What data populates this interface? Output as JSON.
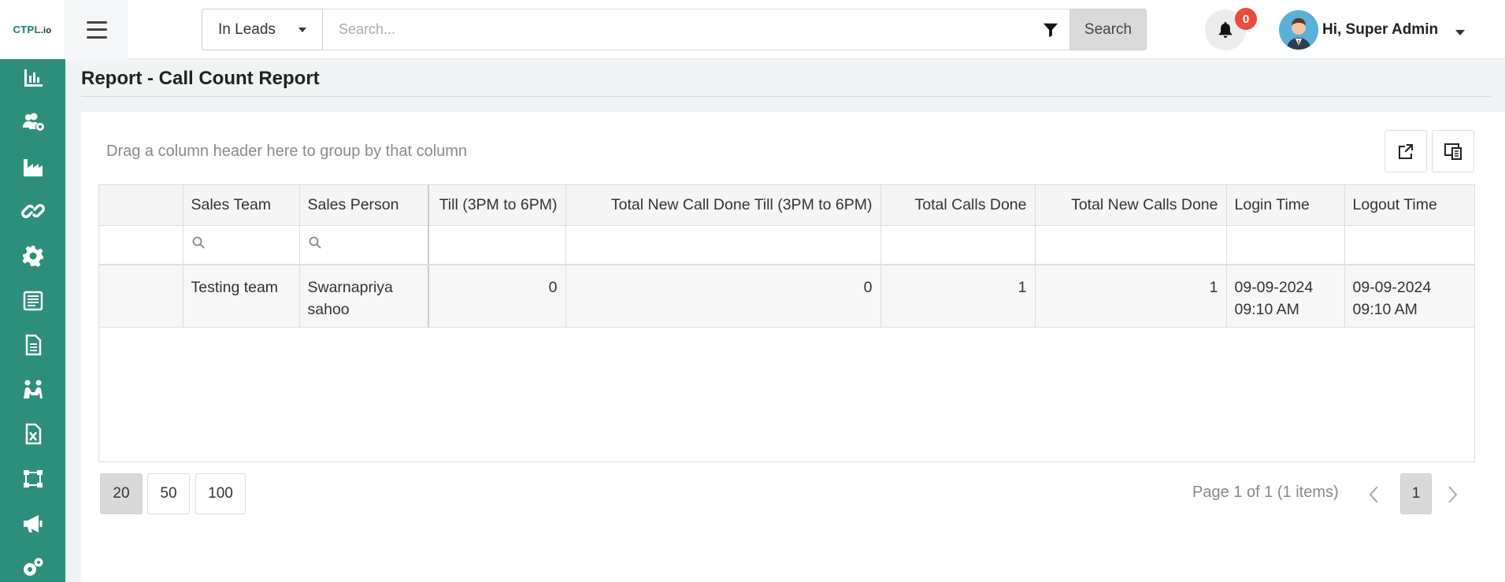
{
  "app": {
    "logo_text": "CTPL",
    "logo_suffix": ".io"
  },
  "search": {
    "scope": "In Leads",
    "placeholder": "Search...",
    "button_label": "Search"
  },
  "notifications": {
    "count": "0"
  },
  "user": {
    "greeting": "Hi, Super Admin"
  },
  "sidebar": {
    "items": [
      {
        "icon": "bar-chart-icon"
      },
      {
        "icon": "users-cog-icon"
      },
      {
        "icon": "industry-icon"
      },
      {
        "icon": "link-icon"
      },
      {
        "icon": "gear-icon"
      },
      {
        "icon": "newspaper-icon"
      },
      {
        "icon": "document-icon"
      },
      {
        "icon": "people-meeting-icon"
      },
      {
        "icon": "excel-file-icon"
      },
      {
        "icon": "network-icon"
      },
      {
        "icon": "megaphone-icon"
      },
      {
        "icon": "cogs-icon"
      }
    ],
    "color": "#2d8f7b"
  },
  "page": {
    "title": "Report - Call Count Report"
  },
  "grid": {
    "group_hint": "Drag a column header here to group by that column",
    "columns": [
      "",
      "Sales Team",
      "Sales Person",
      "Till (3PM to 6PM)",
      "Total New Call Done Till (3PM to 6PM)",
      "Total Calls Done",
      "Total New Calls Done",
      "Login Time",
      "Logout Time"
    ],
    "rows": [
      {
        "sales_team": "Testing team",
        "sales_person_line1": "Swarnapriya",
        "sales_person_line2": "sahoo",
        "till_3_6": "0",
        "new_till_3_6": "0",
        "total_calls": "1",
        "total_new_calls": "1",
        "login_line1": "09-09-2024",
        "login_line2": "09:10 AM",
        "logout_line1": "09-09-2024",
        "logout_line2": "09:10 AM"
      }
    ]
  },
  "pager": {
    "sizes": [
      "20",
      "50",
      "100"
    ],
    "active_size": "20",
    "info": "Page 1 of 1 (1 items)",
    "current_page": "1"
  }
}
